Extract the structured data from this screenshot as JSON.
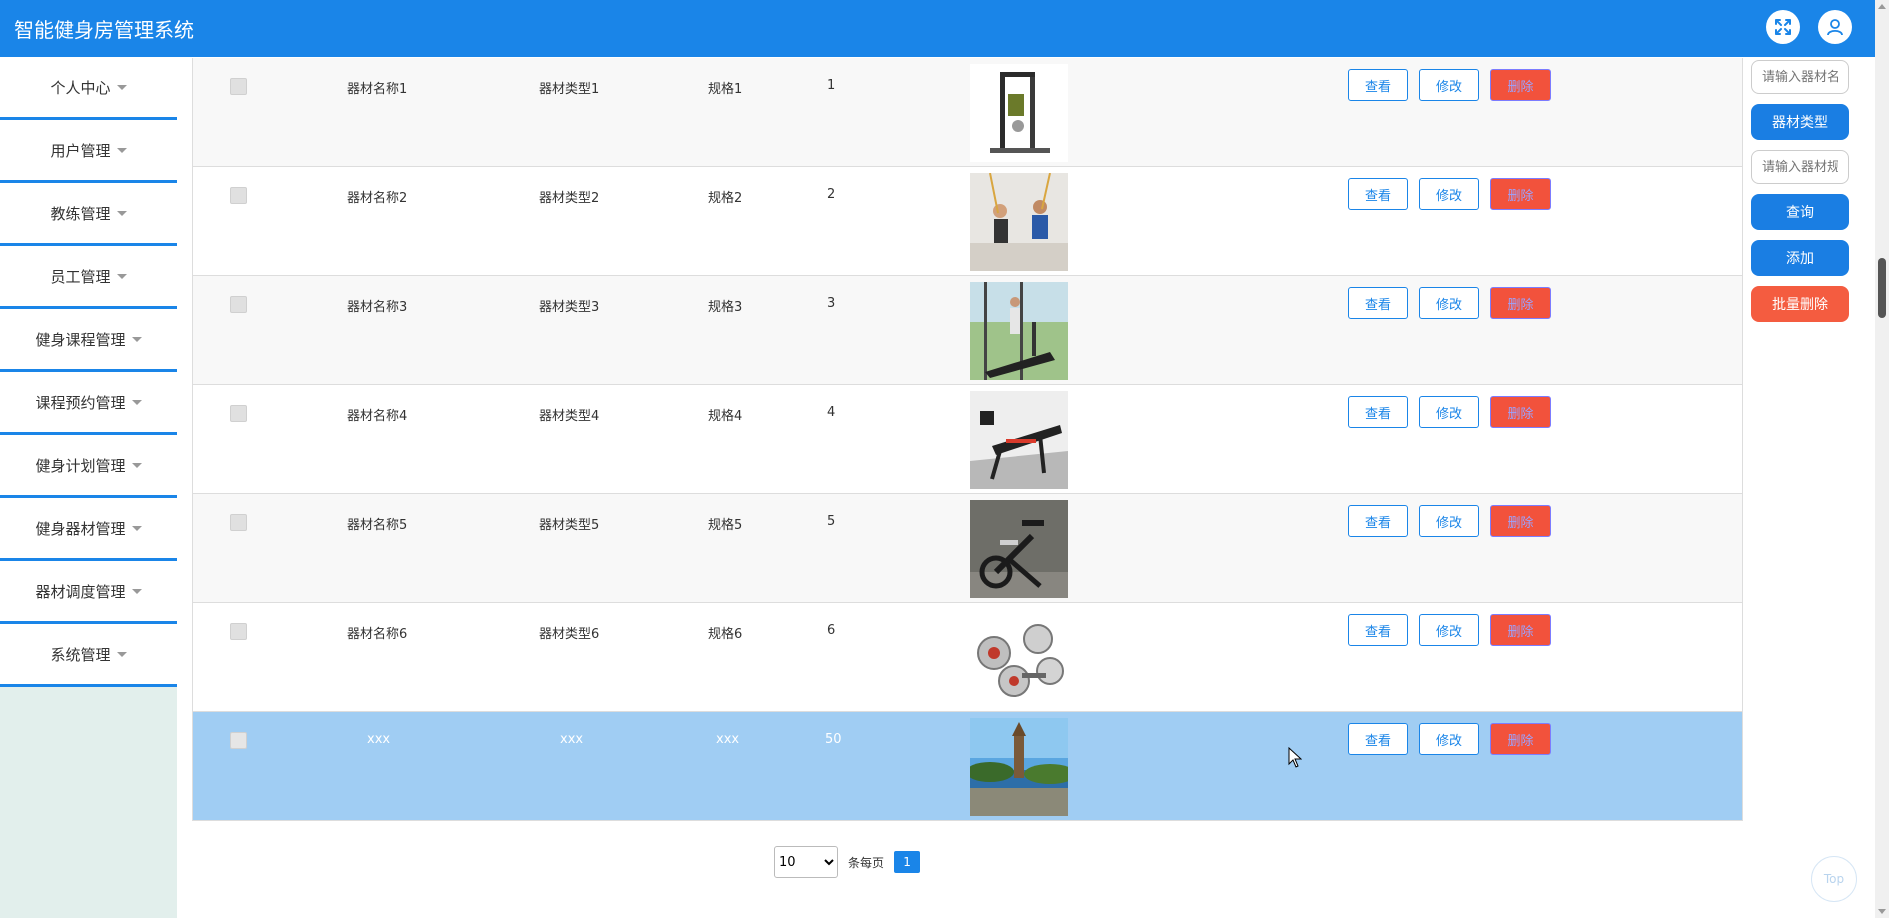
{
  "app": {
    "title": "智能健身房管理系统"
  },
  "colors": {
    "primary": "#1a85e8",
    "danger": "#f2523c",
    "selected_row": "#a0cdf3",
    "sidebar_bg": "#e2efec"
  },
  "header": {
    "fullscreen_icon": "fullscreen-icon",
    "avatar_icon": "user-icon"
  },
  "sidebar": {
    "items": [
      {
        "label": "个人中心"
      },
      {
        "label": "用户管理"
      },
      {
        "label": "教练管理"
      },
      {
        "label": "员工管理"
      },
      {
        "label": "健身课程管理"
      },
      {
        "label": "课程预约管理"
      },
      {
        "label": "健身计划管理"
      },
      {
        "label": "健身器材管理"
      },
      {
        "label": "器材调度管理"
      },
      {
        "label": "系统管理"
      }
    ]
  },
  "table": {
    "rows": [
      {
        "name": "器材名称1",
        "type": "器材类型1",
        "spec": "规格1",
        "qty": "1",
        "image": "home-gym"
      },
      {
        "name": "器材名称2",
        "type": "器材类型2",
        "spec": "规格2",
        "qty": "2",
        "image": "suspension-trainer"
      },
      {
        "name": "器材名称3",
        "type": "器材类型3",
        "spec": "规格3",
        "qty": "3",
        "image": "treadmill"
      },
      {
        "name": "器材名称4",
        "type": "器材类型4",
        "spec": "规格4",
        "qty": "4",
        "image": "weight-bench"
      },
      {
        "name": "器材名称5",
        "type": "器材类型5",
        "spec": "规格5",
        "qty": "5",
        "image": "spin-bike"
      },
      {
        "name": "器材名称6",
        "type": "器材类型6",
        "spec": "规格6",
        "qty": "6",
        "image": "dumbbells"
      },
      {
        "name": "xxx",
        "type": "xxx",
        "spec": "xxx",
        "qty": "50",
        "image": "tower-landscape"
      }
    ],
    "actions": {
      "view": "查看",
      "edit": "修改",
      "delete": "删除"
    }
  },
  "pager": {
    "page_size": "10",
    "per_page_label": "条每页",
    "current_page": "1"
  },
  "right_panel": {
    "input1_placeholder": "请输入器材名称",
    "type_button": "器材类型",
    "input2_placeholder": "请输入器材规格",
    "search_button": "查询",
    "add_button": "添加",
    "batch_delete_button": "批量删除"
  },
  "to_top": {
    "label": "Top"
  }
}
